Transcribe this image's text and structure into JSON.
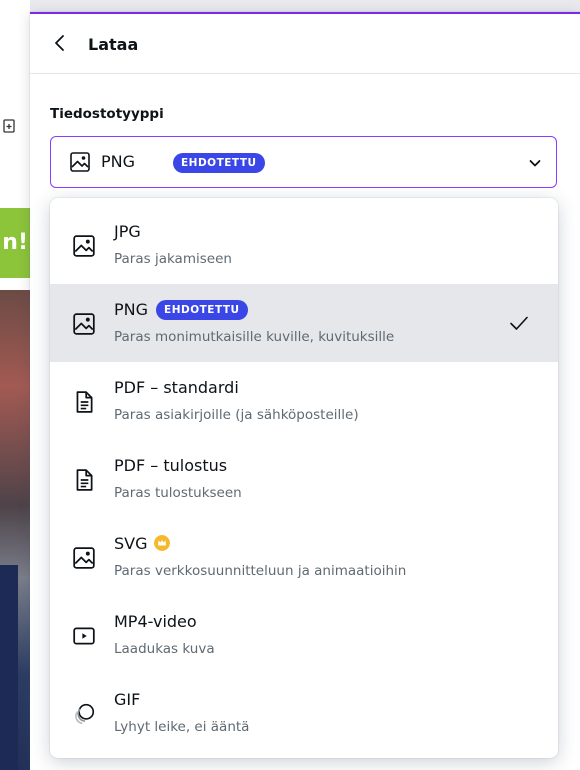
{
  "panel": {
    "title": "Lataa",
    "field_label": "Tiedostotyyppi",
    "selected": {
      "name": "PNG",
      "badge": "EHDOTETTU"
    }
  },
  "background": {
    "green_text": "n!"
  },
  "options": [
    {
      "name": "JPG",
      "desc": "Paras jakamiseen",
      "icon": "image-icon"
    },
    {
      "name": "PNG",
      "badge": "EHDOTETTU",
      "desc": "Paras monimutkaisille kuville, kuvituksille",
      "icon": "image-icon",
      "selected": true
    },
    {
      "name": "PDF – standardi",
      "desc": "Paras asiakirjoille (ja sähköposteille)",
      "icon": "document-icon"
    },
    {
      "name": "PDF – tulostus",
      "desc": "Paras tulostukseen",
      "icon": "document-icon"
    },
    {
      "name": "SVG",
      "desc": "Paras verkkosuunnitteluun ja animaatioihin",
      "icon": "image-icon",
      "premium": true
    },
    {
      "name": "MP4-video",
      "desc": "Laadukas kuva",
      "icon": "video-icon"
    },
    {
      "name": "GIF",
      "desc": "Lyhyt leike, ei ääntä",
      "icon": "gif-icon"
    }
  ],
  "colors": {
    "accent": "#8b3dff",
    "badge": "#3a47e6",
    "crown": "#f5b92b",
    "selected_row": "#e5e7eb"
  }
}
